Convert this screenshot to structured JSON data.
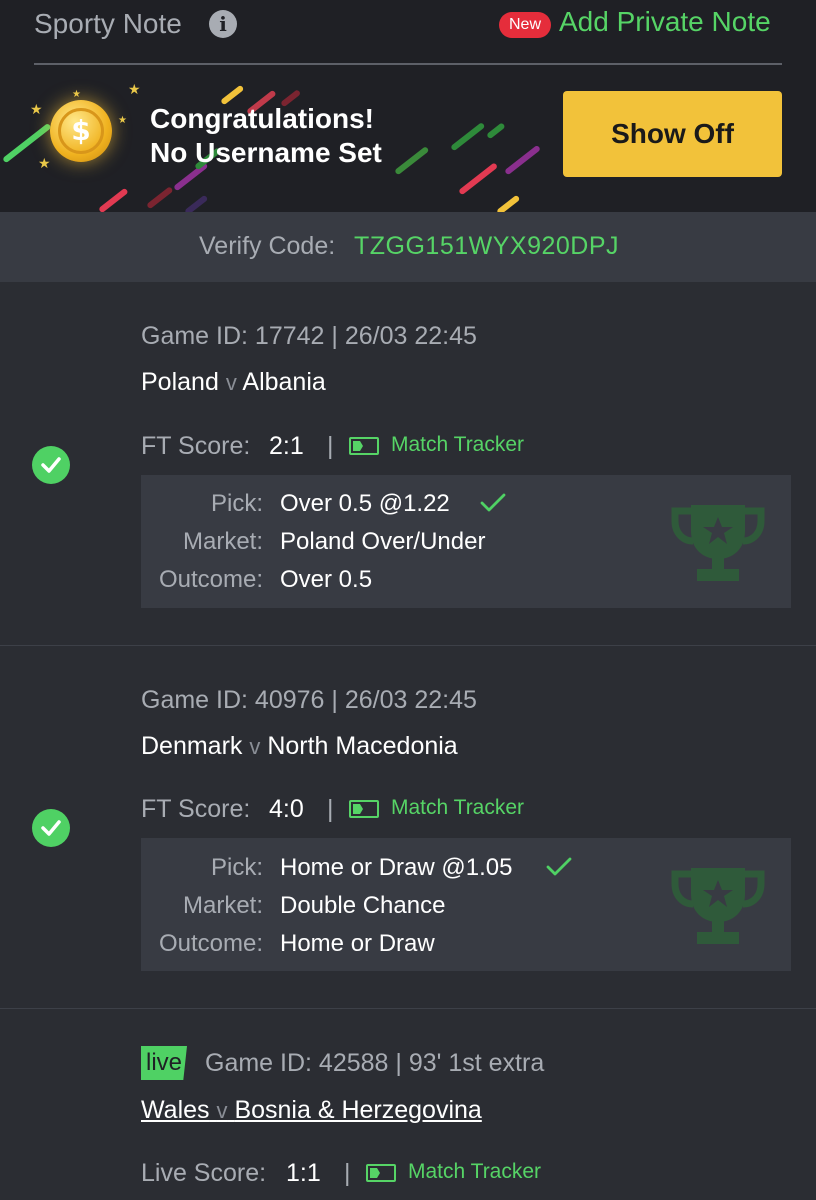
{
  "header": {
    "title": "Sporty Note",
    "info_icon": "info-icon",
    "new_badge": "New",
    "add_note": "Add Private Note"
  },
  "banner": {
    "line1": "Congratulations!",
    "line2": "No Username Set",
    "button": "Show Off",
    "coin_symbol": "$"
  },
  "verify": {
    "label": "Verify Code:",
    "code": "TZGG151WYX920DPJ"
  },
  "bets": [
    {
      "game_id": "Game ID: 17742 | 26/03 22:45",
      "home": "Poland",
      "sep": "v",
      "away": "Albania",
      "score_label": "FT Score:",
      "score": "2:1",
      "pipe": "|",
      "tracker": "Match Tracker",
      "pick_label": "Pick:",
      "pick": "Over 0.5 @1.22",
      "market_label": "Market:",
      "market": "Poland Over/Under",
      "outcome_label": "Outcome:",
      "outcome": "Over 0.5",
      "status": "won"
    },
    {
      "game_id": "Game ID: 40976 | 26/03 22:45",
      "home": "Denmark",
      "sep": "v",
      "away": "North Macedonia",
      "score_label": "FT Score:",
      "score": "4:0",
      "pipe": "|",
      "tracker": "Match Tracker",
      "pick_label": "Pick:",
      "pick": "Home or Draw @1.05",
      "market_label": "Market:",
      "market": "Double Chance",
      "outcome_label": "Outcome:",
      "outcome": "Home or Draw",
      "status": "won"
    },
    {
      "live": "live",
      "game_id": "Game ID: 42588 | 93' 1st extra",
      "home": "Wales",
      "sep": "v",
      "away": "Bosnia & Herzegovina",
      "score_label": "Live Score:",
      "score": "1:1",
      "pipe": "|",
      "tracker": "Match Tracker"
    }
  ],
  "colors": {
    "accent_green": "#56d466",
    "button_yellow": "#f2c23a",
    "badge_red": "#e52d3b",
    "background": "#2b2d33"
  }
}
